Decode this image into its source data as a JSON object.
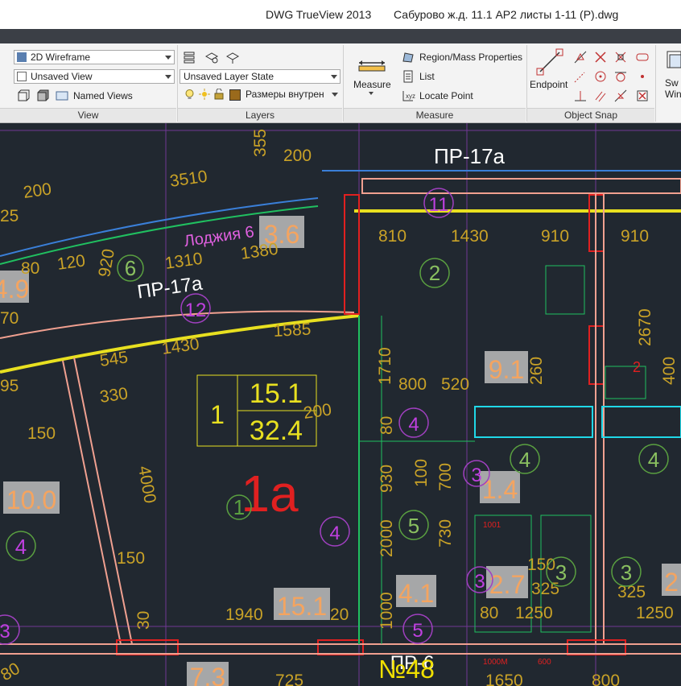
{
  "window": {
    "app": "DWG TrueView 2013",
    "file": "Сабурово ж.д. 11.1 АР2 листы 1-11 (Р).dwg"
  },
  "ribbon": {
    "view": {
      "visual_style": "2D Wireframe",
      "saved_view": "Unsaved View",
      "named_views": "Named Views",
      "label": "View"
    },
    "layers": {
      "layer_state": "Unsaved Layer State",
      "current_layer": "Размеры внутрен",
      "label": "Layers"
    },
    "measure": {
      "measure_button": "Measure",
      "region_mass": "Region/Mass Properties",
      "list": "List",
      "locate_point": "Locate Point",
      "label": "Measure"
    },
    "object_snap": {
      "endpoint": "Endpoint",
      "label": "Object Snap"
    },
    "switch_windows": "Sw Win"
  },
  "drawing": {
    "room_tags": [
      "ПР-17а",
      "ПР-17а",
      "ПР-6"
    ],
    "balcony_label": "Лоджия 6",
    "apartment_number": "1a",
    "plate": {
      "rooms": "1",
      "living_area": "15.1",
      "total_area": "32.4"
    },
    "area_labels": [
      "3.6",
      "4.9",
      "10.0",
      "15.1",
      "9.1",
      "1.4",
      "4.1",
      "2.7",
      "7.3",
      "2"
    ],
    "dims_orange": [
      "355",
      "200",
      "3510",
      "200",
      "25",
      "810",
      "1430",
      "910",
      "910",
      "1310",
      "1380",
      "920",
      "120",
      "80",
      "70",
      "1585",
      "1430",
      "545",
      "330",
      "95",
      "150",
      "1710",
      "800",
      "520",
      "260",
      "2670",
      "400",
      "100",
      "930",
      "700",
      "730",
      "80",
      "2000",
      "1000",
      "4000",
      "150",
      "30",
      "1940",
      "20",
      "150",
      "325",
      "325",
      "1250",
      "80",
      "1250",
      "80",
      "725",
      "1650",
      "800",
      "200"
    ],
    "circle_numbers_green": [
      "6",
      "2",
      "1",
      "5",
      "3",
      "3",
      "4",
      "4",
      "4"
    ],
    "circle_numbers_magenta": [
      "11",
      "12",
      "4",
      "4",
      "4",
      "3",
      "3",
      "5",
      "3"
    ],
    "sheet_mark": "№48",
    "small_red": "2",
    "sub_labels": [
      "1001",
      "1000M",
      "600"
    ]
  },
  "colors": {
    "background": "#212830",
    "dimension": "#c9a227",
    "area_label": "#f4a460",
    "apartment": "#e02020"
  }
}
